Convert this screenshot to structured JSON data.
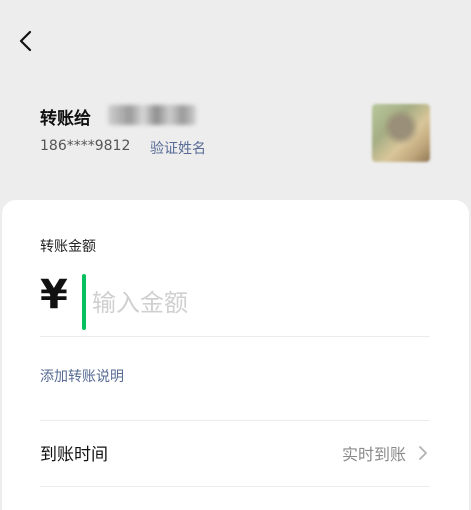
{
  "header": {
    "back_icon": "chevron-left-icon"
  },
  "recipient": {
    "title": "转账给",
    "phone": "186****9812",
    "verify_label": "验证姓名"
  },
  "transfer": {
    "amount_label": "转账金额",
    "currency_symbol": "¥",
    "amount_placeholder": "输入金额",
    "amount_value": "",
    "add_note_label": "添加转账说明",
    "arrival_label": "到账时间",
    "arrival_value": "实时到账"
  },
  "colors": {
    "accent_green": "#07c160",
    "link_blue": "#576b95",
    "page_background": "#ededed"
  }
}
